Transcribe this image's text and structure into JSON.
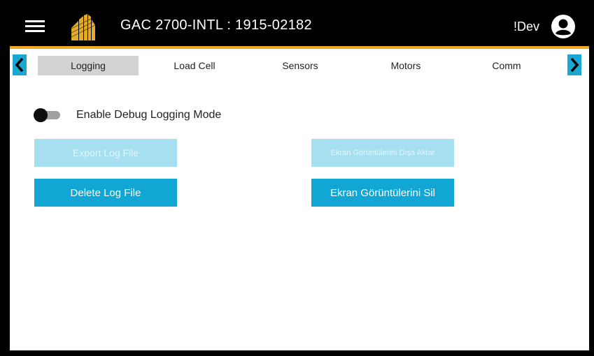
{
  "header": {
    "title": "GAC 2700-INTL : 1915-02182",
    "user_label": "!Dev",
    "accent_color": "#f2a81d"
  },
  "tabs": [
    {
      "label": "Logging",
      "active": true
    },
    {
      "label": "Load Cell",
      "active": false
    },
    {
      "label": "Sensors",
      "active": false
    },
    {
      "label": "Motors",
      "active": false
    },
    {
      "label": "Comm",
      "active": false
    }
  ],
  "logging": {
    "debug_toggle_label": "Enable Debug Logging Mode",
    "debug_toggle_on": false,
    "export_log_button": "Export Log File",
    "export_screenshots_button": "Ekran Görüntülerini Dışa Aktar",
    "delete_log_button": "Delete Log File",
    "delete_screenshots_button": "Ekran Görüntülerini Sil"
  },
  "colors": {
    "primary_button": "#11a6d4",
    "disabled_button": "#a5dff0",
    "tab_active_bg": "#d3d3d3"
  },
  "icons": {
    "menu": "hamburger-menu-icon",
    "logo": "brand-logo-icon",
    "avatar": "account-circle-icon",
    "tab_left": "chevron-left-icon",
    "tab_right": "chevron-right-icon"
  }
}
